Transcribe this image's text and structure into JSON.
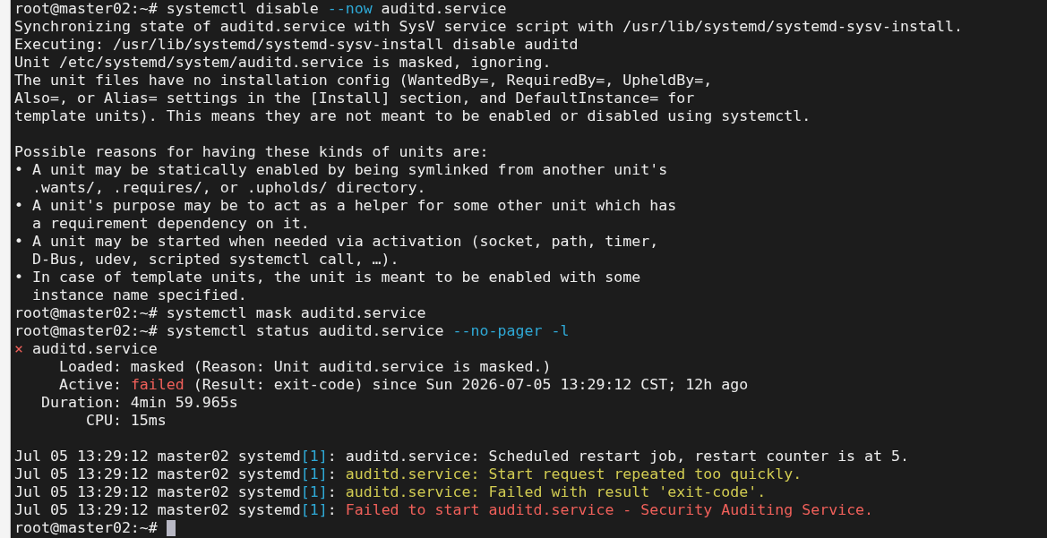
{
  "terminal": {
    "lines": [
      {
        "kind": "command",
        "segments": [
          {
            "kind": "plain",
            "text": "root@master02:~# systemctl disable "
          },
          {
            "kind": "option",
            "text": "--now"
          },
          {
            "kind": "plain",
            "text": " auditd.service"
          }
        ]
      },
      {
        "kind": "output",
        "segments": [
          {
            "kind": "plain",
            "text": "Synchronizing state of auditd.service with SysV service script with /usr/lib/systemd/systemd-sysv-install."
          }
        ]
      },
      {
        "kind": "output",
        "segments": [
          {
            "kind": "plain",
            "text": "Executing: /usr/lib/systemd/systemd-sysv-install disable auditd"
          }
        ]
      },
      {
        "kind": "output",
        "segments": [
          {
            "kind": "plain",
            "text": "Unit /etc/systemd/system/auditd.service is masked, ignoring."
          }
        ]
      },
      {
        "kind": "output",
        "segments": [
          {
            "kind": "plain",
            "text": "The unit files have no installation config (WantedBy=, RequiredBy=, UpheldBy=,"
          }
        ]
      },
      {
        "kind": "output",
        "segments": [
          {
            "kind": "plain",
            "text": "Also=, or Alias= settings in the [Install] section, and DefaultInstance= for"
          }
        ]
      },
      {
        "kind": "output",
        "segments": [
          {
            "kind": "plain",
            "text": "template units). This means they are not meant to be enabled or disabled using systemctl."
          }
        ]
      },
      {
        "kind": "blank"
      },
      {
        "kind": "output",
        "segments": [
          {
            "kind": "plain",
            "text": "Possible reasons for having these kinds of units are:"
          }
        ]
      },
      {
        "kind": "output",
        "segments": [
          {
            "kind": "plain",
            "text": "• A unit may be statically enabled by being symlinked from another unit's"
          }
        ]
      },
      {
        "kind": "output",
        "segments": [
          {
            "kind": "plain",
            "text": "  .wants/, .requires/, or .upholds/ directory."
          }
        ]
      },
      {
        "kind": "output",
        "segments": [
          {
            "kind": "plain",
            "text": "• A unit's purpose may be to act as a helper for some other unit which has"
          }
        ]
      },
      {
        "kind": "output",
        "segments": [
          {
            "kind": "plain",
            "text": "  a requirement dependency on it."
          }
        ]
      },
      {
        "kind": "output",
        "segments": [
          {
            "kind": "plain",
            "text": "• A unit may be started when needed via activation (socket, path, timer,"
          }
        ]
      },
      {
        "kind": "output",
        "segments": [
          {
            "kind": "plain",
            "text": "  D-Bus, udev, scripted systemctl call, …)."
          }
        ]
      },
      {
        "kind": "output",
        "segments": [
          {
            "kind": "plain",
            "text": "• In case of template units, the unit is meant to be enabled with some"
          }
        ]
      },
      {
        "kind": "output",
        "segments": [
          {
            "kind": "plain",
            "text": "  instance name specified."
          }
        ]
      },
      {
        "kind": "command",
        "segments": [
          {
            "kind": "plain",
            "text": "root@master02:~# systemctl mask auditd.service"
          }
        ]
      },
      {
        "kind": "command",
        "segments": [
          {
            "kind": "plain",
            "text": "root@master02:~# systemctl status auditd.service "
          },
          {
            "kind": "option",
            "text": "--no-pager -l"
          }
        ]
      },
      {
        "kind": "output",
        "segments": [
          {
            "kind": "error",
            "text": "×"
          },
          {
            "kind": "plain",
            "text": " auditd.service"
          }
        ]
      },
      {
        "kind": "output",
        "segments": [
          {
            "kind": "plain",
            "text": "     Loaded: masked (Reason: Unit auditd.service is masked.)"
          }
        ]
      },
      {
        "kind": "output",
        "segments": [
          {
            "kind": "plain",
            "text": "     Active: "
          },
          {
            "kind": "error",
            "text": "failed"
          },
          {
            "kind": "plain",
            "text": " (Result: exit-code) since Sun 2026-07-05 13:29:12 CST; 12h ago"
          }
        ]
      },
      {
        "kind": "output",
        "segments": [
          {
            "kind": "plain",
            "text": "   Duration: 4min 59.965s"
          }
        ]
      },
      {
        "kind": "output",
        "segments": [
          {
            "kind": "plain",
            "text": "        CPU: 15ms"
          }
        ]
      },
      {
        "kind": "blank"
      },
      {
        "kind": "output",
        "segments": [
          {
            "kind": "plain",
            "text": "Jul 05 13:29:12 master02 systemd"
          },
          {
            "kind": "option",
            "text": "[1]"
          },
          {
            "kind": "plain",
            "text": ": auditd.service: Scheduled restart job, restart counter is at 5."
          }
        ]
      },
      {
        "kind": "output",
        "segments": [
          {
            "kind": "plain",
            "text": "Jul 05 13:29:12 master02 systemd"
          },
          {
            "kind": "option",
            "text": "[1]"
          },
          {
            "kind": "plain",
            "text": ": "
          },
          {
            "kind": "warning",
            "text": "auditd.service: Start request repeated too quickly."
          }
        ]
      },
      {
        "kind": "output",
        "segments": [
          {
            "kind": "plain",
            "text": "Jul 05 13:29:12 master02 systemd"
          },
          {
            "kind": "option",
            "text": "[1]"
          },
          {
            "kind": "plain",
            "text": ": "
          },
          {
            "kind": "warning",
            "text": "auditd.service: Failed with result 'exit-code'."
          }
        ]
      },
      {
        "kind": "output",
        "segments": [
          {
            "kind": "plain",
            "text": "Jul 05 13:29:12 master02 systemd"
          },
          {
            "kind": "option",
            "text": "[1]"
          },
          {
            "kind": "plain",
            "text": ": "
          },
          {
            "kind": "error",
            "text": "Failed to start auditd.service - Security Auditing Service."
          }
        ]
      },
      {
        "kind": "prompt",
        "segments": [
          {
            "kind": "plain",
            "text": "root@master02:~# "
          }
        ]
      }
    ]
  }
}
